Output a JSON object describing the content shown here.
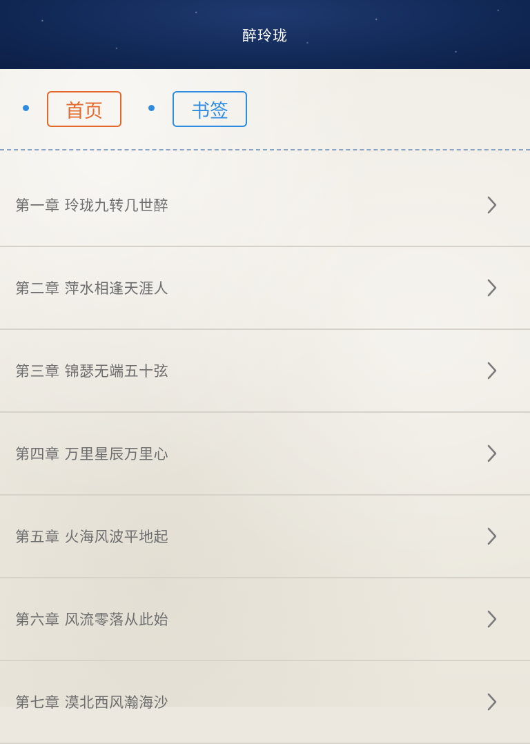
{
  "header": {
    "title": "醉玲珑"
  },
  "tabs": {
    "home_label": "首页",
    "bookmark_label": "书签"
  },
  "colors": {
    "header_bg": "#122a58",
    "home_accent": "#e2682b",
    "bookmark_accent": "#2e8be0"
  },
  "chapters": [
    {
      "label": "第一章 玲珑九转几世醉"
    },
    {
      "label": "第二章 萍水相逢天涯人"
    },
    {
      "label": "第三章 锦瑟无端五十弦"
    },
    {
      "label": "第四章 万里星辰万里心"
    },
    {
      "label": "第五章 火海风波平地起"
    },
    {
      "label": "第六章 风流零落从此始"
    },
    {
      "label": "第七章 漠北西风瀚海沙"
    }
  ],
  "icons": {
    "row_arrow": "chevron-right-icon",
    "tab_bullet": "bullet-dot-icon"
  }
}
